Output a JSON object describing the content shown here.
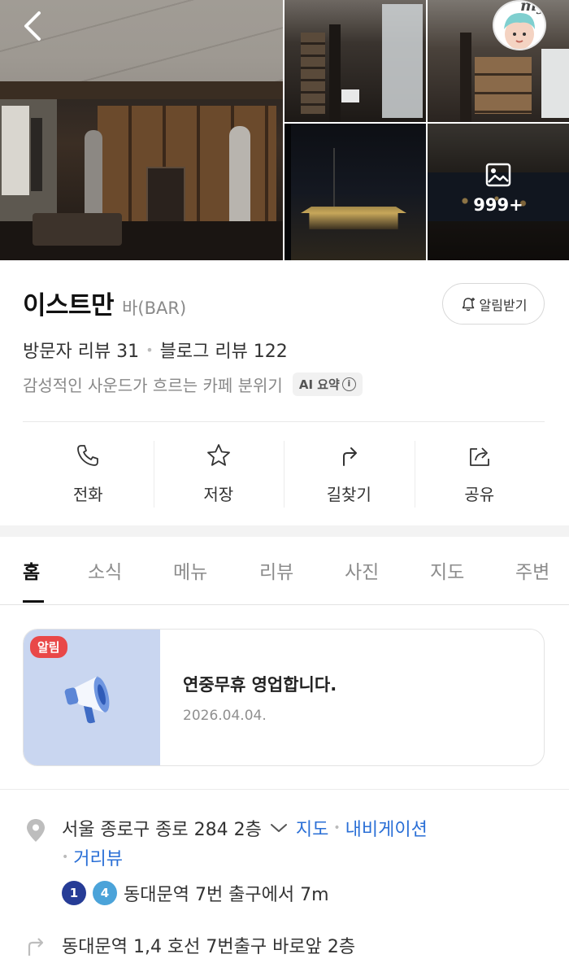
{
  "photos": {
    "more_count": "999+",
    "avatar_badge": "my"
  },
  "place": {
    "name": "이스트만",
    "category": "바(BAR)",
    "alarm_label": "알림받기",
    "visitor_reviews": "방문자 리뷰 31",
    "blog_reviews": "블로그 리뷰 122",
    "summary": "감성적인 사운드가 흐르는 카페 분위기",
    "ai_label": "AI 요약",
    "ai_info": "i"
  },
  "actions": [
    {
      "label": "전화",
      "icon": "phone-icon"
    },
    {
      "label": "저장",
      "icon": "star-icon"
    },
    {
      "label": "길찾기",
      "icon": "directions-icon"
    },
    {
      "label": "공유",
      "icon": "share-icon"
    }
  ],
  "tabs": [
    "홈",
    "소식",
    "메뉴",
    "리뷰",
    "사진",
    "지도",
    "주변"
  ],
  "active_tab": "홈",
  "notice": {
    "tag": "알림",
    "title": "연중무휴 영업합니다.",
    "date": "2026.04.04."
  },
  "address": {
    "text": "서울 종로구 종로 284 2층",
    "map_link": "지도",
    "navi_link": "내비게이션",
    "street_view_link": "거리뷰",
    "subway_lines": [
      {
        "number": "1",
        "color": "#263c96"
      },
      {
        "number": "4",
        "color": "#4ba3d9"
      }
    ],
    "subway_text": "동대문역 7번 출구에서 7m",
    "directions": "동대문역 1,4 호선 7번출구 바로앞 2층"
  },
  "colors": {
    "link": "#2a6fd6",
    "notice_tag": "#e94848",
    "notice_thumb": "#c9d6f0"
  }
}
